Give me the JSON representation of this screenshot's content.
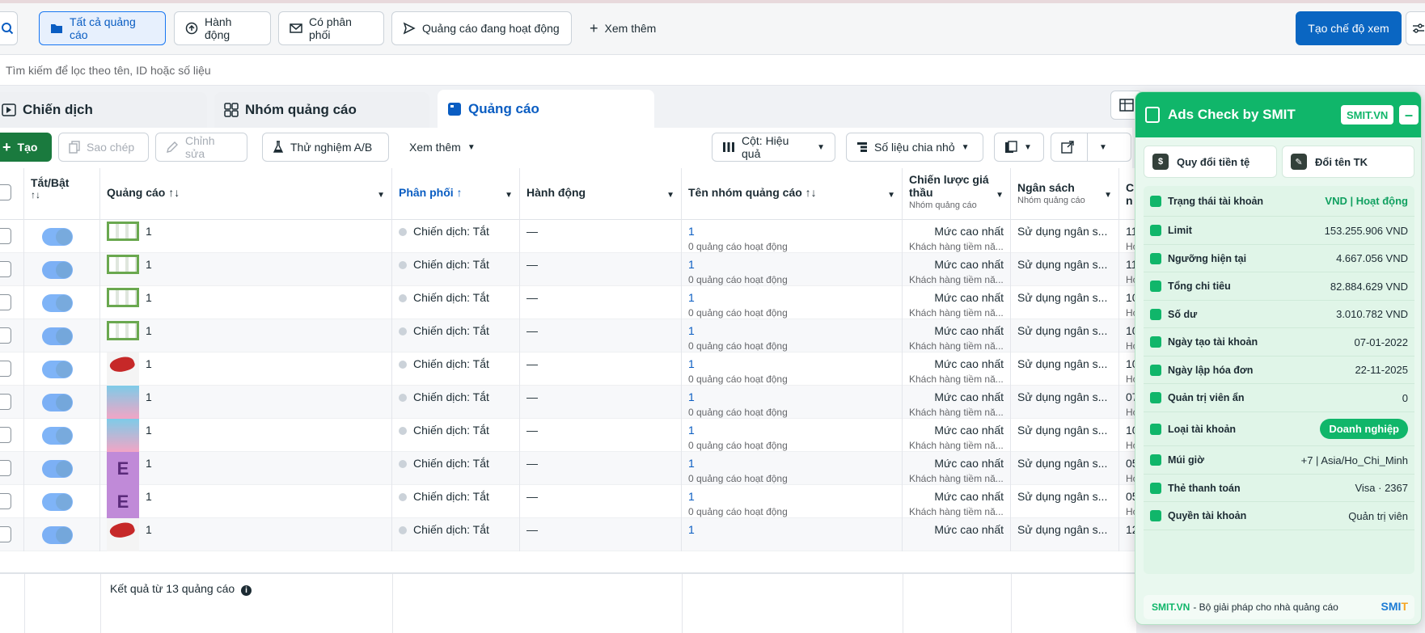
{
  "filters": {
    "all_ads": "Tất cả quảng cáo",
    "actions": "Hành động",
    "has_delivery": "Có phân phối",
    "active_ads": "Quảng cáo đang hoạt động",
    "see_more": "Xem thêm",
    "create_view": "Tạo chế độ xem"
  },
  "search": {
    "placeholder": "Tìm kiếm để lọc theo tên, ID hoặc số liệu"
  },
  "tabs": {
    "campaigns": "Chiến dịch",
    "adsets": "Nhóm quảng cáo",
    "ads": "Quảng cáo"
  },
  "toolbar": {
    "create": "Tạo",
    "duplicate": "Sao chép",
    "edit": "Chỉnh sửa",
    "ab_test": "Thử nghiệm A/B",
    "more": "Xem thêm",
    "columns": "Cột: Hiệu quả",
    "breakdown": "Số liệu chia nhỏ"
  },
  "columns": {
    "toggle": "Tắt/Bật",
    "toggle_sort": "↑↓",
    "ad": "Quảng cáo ↑↓",
    "delivery": "Phân phối ↑",
    "actions": "Hành động",
    "adset_name": "Tên nhóm quảng cáo ↑↓",
    "bid_strategy": "Chiến lược giá thầu",
    "bid_strategy_sub": "Nhóm quảng cáo",
    "budget": "Ngân sách",
    "budget_sub": "Nhóm quảng cáo",
    "next_col": "C",
    "next_col_sub": "n"
  },
  "rows": [
    {
      "name": "1",
      "delivery": "Chiến dịch: Tắt",
      "action": "—",
      "adset": "1",
      "adset_sub": "0 quảng cáo hoạt động",
      "bid": "Mức cao nhất",
      "bid_sub": "Khách hàng tiềm nă...",
      "budget": "Sử dụng ngân s...",
      "next": "11",
      "next_sub": "Hơ",
      "thumb": "green"
    },
    {
      "name": "1",
      "delivery": "Chiến dịch: Tắt",
      "action": "—",
      "adset": "1",
      "adset_sub": "0 quảng cáo hoạt động",
      "bid": "Mức cao nhất",
      "bid_sub": "Khách hàng tiềm nă...",
      "budget": "Sử dụng ngân s...",
      "next": "11",
      "next_sub": "Hơ",
      "thumb": "green"
    },
    {
      "name": "1",
      "delivery": "Chiến dịch: Tắt",
      "action": "—",
      "adset": "1",
      "adset_sub": "0 quảng cáo hoạt động",
      "bid": "Mức cao nhất",
      "bid_sub": "Khách hàng tiềm nă...",
      "budget": "Sử dụng ngân s...",
      "next": "10",
      "next_sub": "Hơ",
      "thumb": "green"
    },
    {
      "name": "1",
      "delivery": "Chiến dịch: Tắt",
      "action": "—",
      "adset": "1",
      "adset_sub": "0 quảng cáo hoạt động",
      "bid": "Mức cao nhất",
      "bid_sub": "Khách hàng tiềm nă...",
      "budget": "Sử dụng ngân s...",
      "next": "10",
      "next_sub": "Hơ",
      "thumb": "green"
    },
    {
      "name": "1",
      "delivery": "Chiến dịch: Tắt",
      "action": "—",
      "adset": "1",
      "adset_sub": "0 quảng cáo hoạt động",
      "bid": "Mức cao nhất",
      "bid_sub": "Khách hàng tiềm nă...",
      "budget": "Sử dụng ngân s...",
      "next": "10",
      "next_sub": "Hơ",
      "thumb": "red"
    },
    {
      "name": "1",
      "delivery": "Chiến dịch: Tắt",
      "action": "—",
      "adset": "1",
      "adset_sub": "0 quảng cáo hoạt động",
      "bid": "Mức cao nhất",
      "bid_sub": "Khách hàng tiềm nă...",
      "budget": "Sử dụng ngân s...",
      "next": "07",
      "next_sub": "Hơ",
      "thumb": "blue"
    },
    {
      "name": "1",
      "delivery": "Chiến dịch: Tắt",
      "action": "—",
      "adset": "1",
      "adset_sub": "0 quảng cáo hoạt động",
      "bid": "Mức cao nhất",
      "bid_sub": "Khách hàng tiềm nă...",
      "budget": "Sử dụng ngân s...",
      "next": "10",
      "next_sub": "Hơ",
      "thumb": "blue"
    },
    {
      "name": "1",
      "delivery": "Chiến dịch: Tắt",
      "action": "—",
      "adset": "1",
      "adset_sub": "0 quảng cáo hoạt động",
      "bid": "Mức cao nhất",
      "bid_sub": "Khách hàng tiềm nă...",
      "budget": "Sử dụng ngân s...",
      "next": "05",
      "next_sub": "Hơ",
      "thumb": "purple"
    },
    {
      "name": "1",
      "delivery": "Chiến dịch: Tắt",
      "action": "—",
      "adset": "1",
      "adset_sub": "0 quảng cáo hoạt động",
      "bid": "Mức cao nhất",
      "bid_sub": "Khách hàng tiềm nă...",
      "budget": "Sử dụng ngân s...",
      "next": "05",
      "next_sub": "Hơ",
      "thumb": "purple"
    },
    {
      "name": "1",
      "delivery": "Chiến dịch: Tắt",
      "action": "—",
      "adset": "1",
      "adset_sub": "",
      "bid": "Mức cao nhất",
      "bid_sub": "",
      "budget": "Sử dụng ngân s...",
      "next": "12",
      "next_sub": "",
      "thumb": "red"
    }
  ],
  "footer": {
    "results": "Kết quả từ 13 quảng cáo"
  },
  "thumb_letter": "E",
  "smit": {
    "title": "Ads Check by SMIT",
    "badge": "SMIT.VN",
    "minimize": "–",
    "convert_currency": "Quy đổi tiền tệ",
    "rename_account": "Đổi tên TK",
    "items": [
      {
        "label": "Trạng thái tài khoản",
        "value": "VND | Hoạt động",
        "style": "green"
      },
      {
        "label": "Limit",
        "value": "153.255.906 VND",
        "style": ""
      },
      {
        "label": "Ngưỡng hiện tại",
        "value": "4.667.056 VND",
        "style": ""
      },
      {
        "label": "Tổng chi tiêu",
        "value": "82.884.629 VND",
        "style": ""
      },
      {
        "label": "Số dư",
        "value": "3.010.782 VND",
        "style": ""
      },
      {
        "label": "Ngày tạo tài khoản",
        "value": "07-01-2022",
        "style": ""
      },
      {
        "label": "Ngày lập hóa đơn",
        "value": "22-11-2025",
        "style": ""
      },
      {
        "label": "Quản trị viên ẩn",
        "value": "0",
        "style": ""
      },
      {
        "label": "Loại tài khoản",
        "value": "Doanh nghiệp",
        "style": "pill"
      },
      {
        "label": "Múi giờ",
        "value": "+7 | Asia/Ho_Chi_Minh",
        "style": ""
      },
      {
        "label": "Thẻ thanh toán",
        "value": "Visa · 2367",
        "style": ""
      },
      {
        "label": "Quyền tài khoản",
        "value": "Quản trị viên",
        "style": ""
      }
    ],
    "footer_brand": "SMIT.VN",
    "footer_text": "- Bộ giải pháp cho nhà quảng cáo",
    "logo_a": "SMI",
    "logo_b": "T"
  },
  "colors": {
    "accent": "#0a66c2",
    "smit_green": "#10b66a",
    "create_green": "#1a7a3e"
  }
}
